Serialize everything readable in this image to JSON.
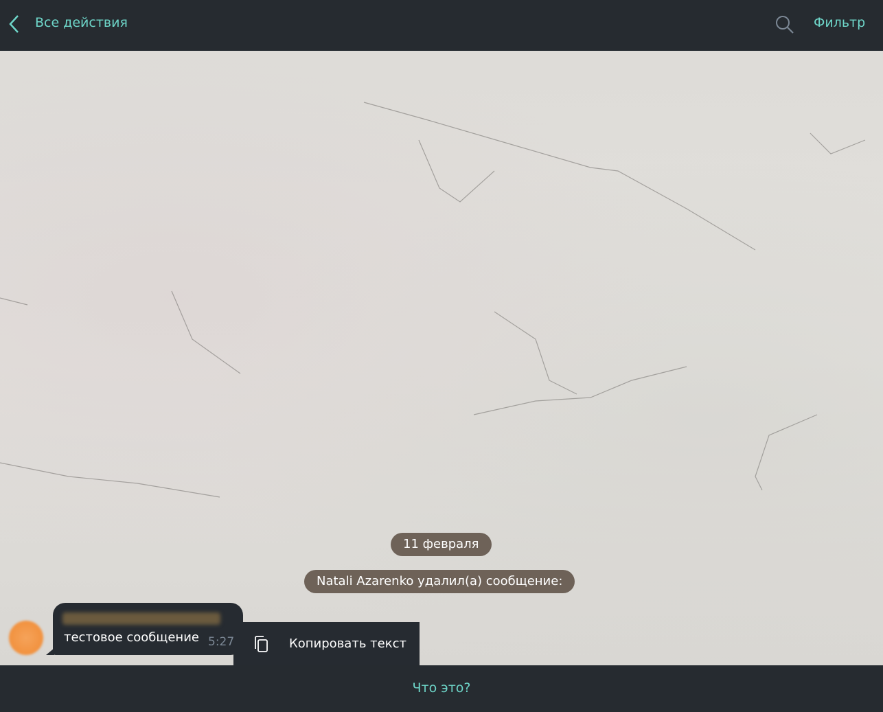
{
  "header": {
    "title": "Все действия",
    "filter_label": "Фильтр"
  },
  "chat": {
    "date_label": "11 февраля",
    "service_message": "Natali Azarenko удалил(а) сообщение:",
    "message": {
      "text": "тестовое сообщение",
      "time": "5:27"
    },
    "context_menu": {
      "copy_label": "Копировать текст"
    }
  },
  "footer": {
    "what_is_this": "Что это?"
  },
  "colors": {
    "accent": "#6ed6c9",
    "bar": "#262b30",
    "pill": "#6e6258"
  }
}
